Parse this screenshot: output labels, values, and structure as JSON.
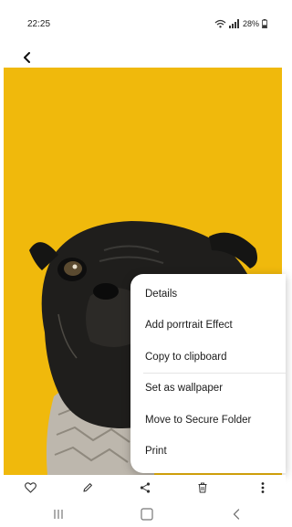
{
  "status_bar": {
    "time": "22:25",
    "battery": "28%"
  },
  "viewer": {
    "back_icon": "chevron-left-icon",
    "photo_background_color": "#F0B90C",
    "photo_subject": "pug-photo"
  },
  "context_menu": {
    "items": [
      "Details",
      "Add porrtrait Effect",
      "Copy to clipboard",
      "Set as wallpaper",
      "Move to Secure Folder",
      "Print"
    ]
  },
  "toolbar": {
    "icons": [
      "heart-icon",
      "pencil-icon",
      "share-icon",
      "trash-icon",
      "more-vertical-icon"
    ]
  },
  "nav_bar": {
    "icons": [
      "recent-apps-icon",
      "home-icon",
      "back-icon"
    ]
  }
}
